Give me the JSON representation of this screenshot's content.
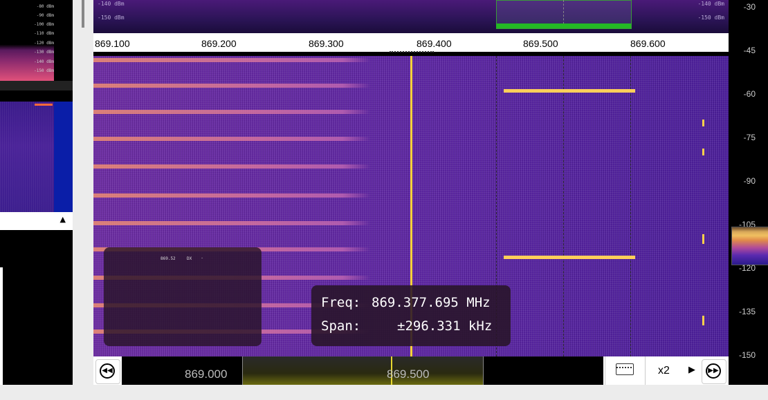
{
  "left_panel": {
    "mini_db_labels": [
      "-80 dBm",
      "-90 dBm",
      "-100 dBm",
      "-110 dBm",
      "-120 dBm",
      "-130 dBm",
      "-140 dBm",
      "-150 dBm"
    ]
  },
  "spectrum": {
    "db_left_top": "-140 dBm",
    "db_left_bottom": "-150 dBm",
    "db_right_top": "-140 dBm",
    "db_right_bottom": "-150 dBm"
  },
  "freq_axis": {
    "ticks": [
      "869.100",
      "869.200",
      "869.300",
      "869.400",
      "869.500",
      "869.600"
    ]
  },
  "info_panel": {
    "freq": "869.52",
    "mode": "DX",
    "dash": "-"
  },
  "tooltip": {
    "freq_label": "Freq:",
    "freq_value": "869.377.695 MHz",
    "span_label": "Span:",
    "span_value": "±296.331 kHz"
  },
  "bottom_bar": {
    "rewind_icon": "rewind-icon",
    "forward_icon": "fast-forward-icon",
    "track_left_label": "869.000",
    "track_center_label": "869.500",
    "keyboard_icon": "keyboard-icon",
    "zoom_label": "x2",
    "zoom_arrow_icon": "play-arrow-icon"
  },
  "right_scale": {
    "labels": [
      "-30",
      "-45",
      "-60",
      "-75",
      "-90",
      "-105",
      "-120",
      "-135",
      "-150"
    ]
  },
  "colors": {
    "carrier": "#ffd23a",
    "selection_green": "#24b824",
    "waterfall_base": "#5a24a0"
  }
}
